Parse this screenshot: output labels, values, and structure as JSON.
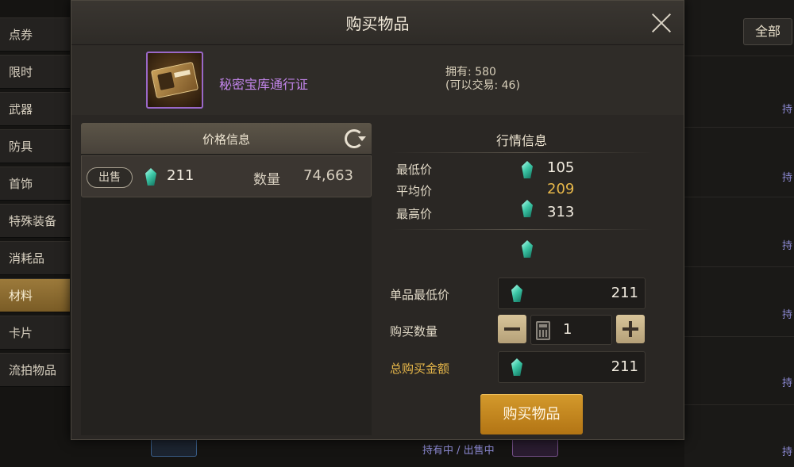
{
  "sidebar": {
    "items": [
      {
        "label": "点券"
      },
      {
        "label": "限时"
      },
      {
        "label": "武器"
      },
      {
        "label": "防具"
      },
      {
        "label": "首饰"
      },
      {
        "label": "特殊装备"
      },
      {
        "label": "消耗品"
      },
      {
        "label": "材料",
        "active": true
      },
      {
        "label": "卡片"
      },
      {
        "label": "流拍物品"
      }
    ]
  },
  "background": {
    "all_button": "全部",
    "hold_label": "持",
    "hold_sell_label": "持有中 / 出售中"
  },
  "modal": {
    "title": "购买物品",
    "item": {
      "name": "秘密宝库通行证",
      "owned": "拥有: 580",
      "tradable": "(可以交易: 46)"
    },
    "price_info": {
      "header": "价格信息",
      "row": {
        "badge": "出售",
        "price": "211",
        "qty_label": "数量",
        "qty": "74,663"
      }
    },
    "market": {
      "title": "行情信息",
      "min_label": "最低价",
      "min_value": "105",
      "avg_label": "平均价",
      "avg_value": "209",
      "max_label": "最高价",
      "max_value": "313"
    },
    "buy": {
      "unit_price_label": "单品最低价",
      "unit_price": "211",
      "quantity_label": "购买数量",
      "quantity": "1",
      "total_label": "总购买金额",
      "total": "211",
      "button_label": "购买物品"
    }
  },
  "colors": {
    "accent_gold": "#e8b84a",
    "item_name_purple": "#c285ea",
    "buy_button": "#c8881e"
  }
}
